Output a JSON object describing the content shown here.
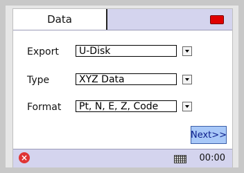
{
  "title": "Data",
  "form": {
    "export_label": "Export",
    "export_value": "U-Disk",
    "type_label": "Type",
    "type_value": "XYZ  Data",
    "format_label": "Format",
    "format_value": "Pt, N, E, Z, Code"
  },
  "buttons": {
    "next_label": "Next>>"
  },
  "status": {
    "clock": "00:00"
  },
  "icons": {
    "battery": "battery-icon",
    "close": "close-icon",
    "keyboard": "keyboard-icon"
  },
  "colors": {
    "battery": "#e00000",
    "titlebar": "#d4d4ee",
    "next_button": "#a8c8f8"
  }
}
